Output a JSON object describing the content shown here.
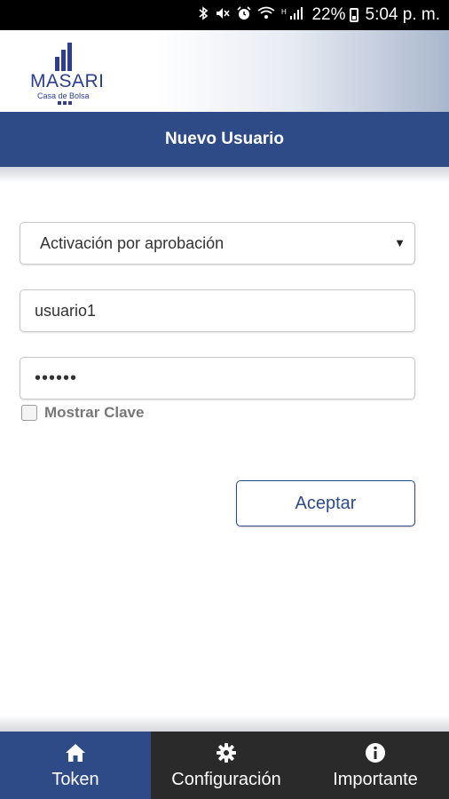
{
  "status_bar": {
    "battery": "22%",
    "time": "5:04 p. m.",
    "icons": [
      "bluetooth-icon",
      "mute-icon",
      "alarm-icon",
      "wifi-icon",
      "signal-icon",
      "battery-icon"
    ]
  },
  "brand": {
    "name": "MASARI",
    "subtitle": "Casa de Bolsa"
  },
  "page": {
    "title": "Nuevo Usuario"
  },
  "form": {
    "activation_select": {
      "selected": "Activación por aprobación"
    },
    "username": {
      "value": "usuario1"
    },
    "password": {
      "value": "••••••"
    },
    "show_password_label": "Mostrar Clave",
    "accept_label": "Aceptar"
  },
  "bottom_nav": {
    "items": [
      {
        "label": "Token",
        "icon": "home-icon",
        "active": true
      },
      {
        "label": "Configuración",
        "icon": "gear-icon",
        "active": false
      },
      {
        "label": "Importante",
        "icon": "info-icon",
        "active": false
      }
    ]
  },
  "colors": {
    "primary": "#2e4a87",
    "nav_inactive": "#2a2a2a"
  }
}
